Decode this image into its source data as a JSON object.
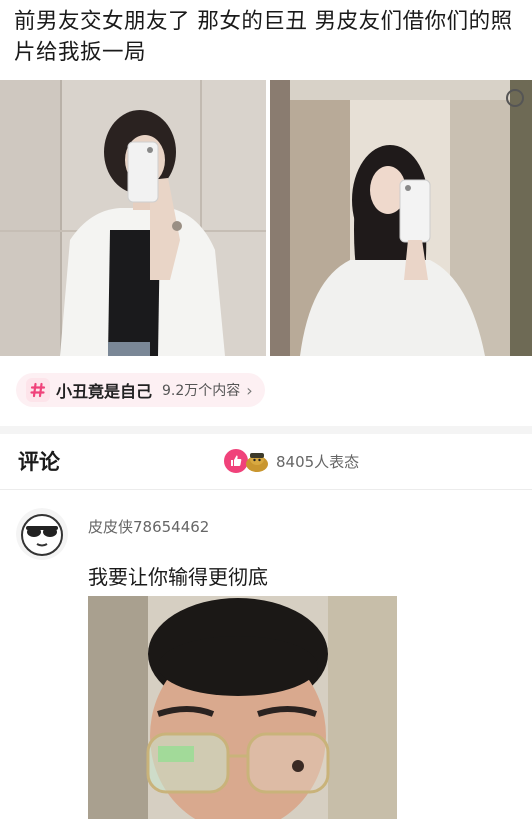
{
  "post": {
    "title": "前男友交女朋友了 那女的巨丑 男皮友们借你们的照片给我扳一局"
  },
  "topic": {
    "name": "小丑竟是自己",
    "count": "9.2万个内容",
    "chevron": "›",
    "icon": "hashtag-icon",
    "accent_color": "#f0427a"
  },
  "comments": {
    "title": "评论",
    "reaction_count": "8405人表态",
    "items": [
      {
        "username": "皮皮侠78654462",
        "text": "我要让你输得更彻底"
      }
    ]
  }
}
